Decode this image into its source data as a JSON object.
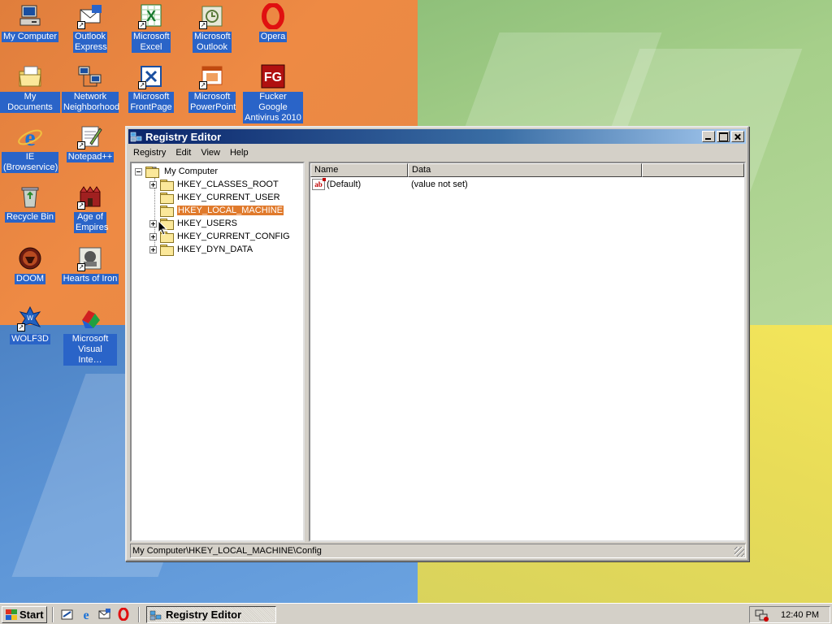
{
  "desktop": {
    "icons": [
      {
        "label": "My Computer",
        "icon": "my-computer-icon"
      },
      {
        "label": "Outlook Express",
        "icon": "outlook-express-icon"
      },
      {
        "label": "Microsoft Excel",
        "icon": "excel-icon"
      },
      {
        "label": "Microsoft Outlook",
        "icon": "outlook-icon"
      },
      {
        "label": "Opera",
        "icon": "opera-icon"
      },
      {
        "label": "My Documents",
        "icon": "my-documents-icon"
      },
      {
        "label": "Network Neighborhood",
        "icon": "network-neighborhood-icon"
      },
      {
        "label": "Microsoft FrontPage",
        "icon": "frontpage-icon"
      },
      {
        "label": "Microsoft PowerPoint",
        "icon": "powerpoint-icon"
      },
      {
        "label": "Fucker Google Antivirus 2010",
        "icon": "antivirus-icon"
      },
      {
        "label": "IE (Browservice)",
        "icon": "internet-explorer-icon"
      },
      {
        "label": "Notepad++",
        "icon": "notepad-icon"
      },
      {
        "label": "Recycle Bin",
        "icon": "recycle-bin-icon"
      },
      {
        "label": "Age of Empires",
        "icon": "age-of-empires-icon"
      },
      {
        "label": "DOOM",
        "icon": "doom-icon"
      },
      {
        "label": "Hearts of Iron",
        "icon": "hearts-of-iron-icon"
      },
      {
        "label": "WOLF3D",
        "icon": "wolf3d-icon"
      },
      {
        "label": "Microsoft Visual Inte…",
        "icon": "visual-interdev-icon"
      }
    ]
  },
  "window": {
    "title": "Registry Editor",
    "menu": [
      "Registry",
      "Edit",
      "View",
      "Help"
    ],
    "tree": {
      "root": "My Computer",
      "keys": [
        "HKEY_CLASSES_ROOT",
        "HKEY_CURRENT_USER",
        "HKEY_LOCAL_MACHINE",
        "HKEY_USERS",
        "HKEY_CURRENT_CONFIG",
        "HKEY_DYN_DATA"
      ],
      "selected": "HKEY_LOCAL_MACHINE"
    },
    "list": {
      "columns": [
        "Name",
        "Data"
      ],
      "rows": [
        {
          "name": "(Default)",
          "data": "(value not set)"
        }
      ]
    },
    "status": "My Computer\\HKEY_LOCAL_MACHINE\\Config"
  },
  "taskbar": {
    "start_label": "Start",
    "task_label": "Registry Editor",
    "clock": "12:40 PM"
  },
  "colors": {
    "selection": "#e07a2c",
    "title_active": "#0a246a",
    "desktop_label_bg": "#2a64c8"
  }
}
